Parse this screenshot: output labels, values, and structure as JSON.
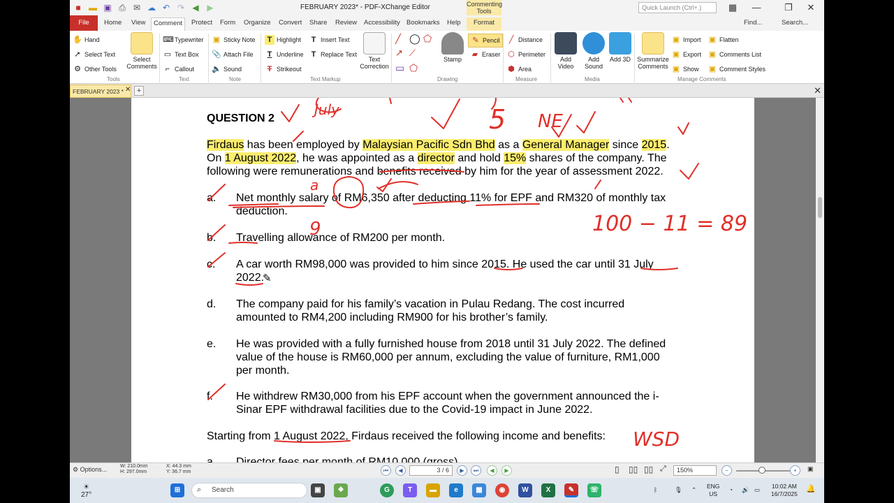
{
  "window": {
    "title": "FEBRUARY 2023* - PDF-XChange Editor",
    "context_tab": "Commenting Tools",
    "quick_launch_placeholder": "Quick Launch (Ctrl+.)",
    "find_label": "Find...",
    "search_label": "Search..."
  },
  "tabs": [
    "File",
    "Home",
    "View",
    "Comment",
    "Protect",
    "Form",
    "Organize",
    "Convert",
    "Share",
    "Review",
    "Accessibility",
    "Bookmarks",
    "Help",
    "Format"
  ],
  "ribbon": {
    "tools": {
      "hand": "Hand",
      "select_text": "Select Text",
      "other_tools": "Other Tools",
      "group": "Tools"
    },
    "select_comments": "Select Comments",
    "text": {
      "typewriter": "Typewriter",
      "text_box": "Text Box",
      "callout": "Callout",
      "group": "Text"
    },
    "note": {
      "sticky_note": "Sticky Note",
      "attach_file": "Attach File",
      "sound": "Sound",
      "group": "Note"
    },
    "markup": {
      "highlight": "Highlight",
      "underline": "Underline",
      "strikeout": "Strikeout",
      "insert_text": "Insert Text",
      "replace_text": "Replace Text",
      "text_correction": "Text Correction",
      "group": "Text Markup"
    },
    "drawing": {
      "stamp": "Stamp",
      "pencil": "Pencil",
      "eraser": "Eraser",
      "group": "Drawing"
    },
    "measure": {
      "distance": "Distance",
      "perimeter": "Perimeter",
      "area": "Area",
      "group": "Measure"
    },
    "media": {
      "add_video": "Add Video",
      "add_sound": "Add Sound",
      "add_3d": "Add 3D",
      "group": "Media"
    },
    "manage": {
      "summarize": "Summarize Comments",
      "import": "Import",
      "export": "Export",
      "show": "Show",
      "flatten": "Flatten",
      "comments_list": "Comments List",
      "comment_styles": "Comment Styles",
      "group": "Manage Comments"
    }
  },
  "document_tab": "FEBRUARY 2023 *",
  "page": {
    "heading": "QUESTION 2",
    "intro": {
      "p1": "Firdaus",
      "p2": " has been employed by ",
      "p3": "Malaysian Pacific Sdn Bhd",
      "p4": " as a ",
      "p5": "General Manager",
      "p6": " since ",
      "p7": "2015",
      "p8": ".",
      "l2a": "On ",
      "l2b": "1 August 2022",
      "l2c": ", he was appointed as a ",
      "l2d": "director",
      "l2e": " and hold ",
      "l2f": "15%",
      "l2g": " shares of the company. The",
      "l3": "following were remunerations and benefits received by him for the year of assessment 2022."
    },
    "items": [
      {
        "label": "a.",
        "line1": "Net monthly salary of RM6,350 after deducting 11% for EPF and RM320 of monthly tax",
        "line2": "deduction."
      },
      {
        "label": "b.",
        "line1": "Travelling allowance of RM200 per month.",
        "line2": ""
      },
      {
        "label": "c.",
        "line1": "A car worth RM98,000 was provided to him since 2015. He used the car until 31 July",
        "line2": "2022."
      },
      {
        "label": "d.",
        "line1": "The company paid for his family’s vacation in Pulau Redang. The cost incurred",
        "line2": "amounted to RM4,200 including RM900 for his brother’s family."
      },
      {
        "label": "e.",
        "line1": "He was provided with a fully furnished house from 2018 until 31 July 2022. The defined",
        "line2": "value of the house is RM60,000 per annum, excluding the value of furniture, RM1,000",
        "line3": "per month."
      },
      {
        "label": "f.",
        "line1": "He withdrew RM30,000 from his EPF account when the government announced the i-",
        "line2": "Sinar EPF withdrawal facilities due to the Covid-19 impact in June 2022."
      }
    ],
    "starting": {
      "a": "Starting from ",
      "b": "1 August 2022",
      "c": ", Firdaus received the following income and benefits:"
    },
    "next_label": "a.",
    "next_line": "Director fees per month of RM10,000 (gross)",
    "handwriting": {
      "top": "July",
      "five": "5",
      "ne": "NE",
      "calc": "100 − 11 = 89",
      "wsd": "WSD",
      "a": "a",
      "nine": "9"
    }
  },
  "status": {
    "options": "Options...",
    "width": "W: 210.0mm",
    "height": "H: 297.0mm",
    "x": "X: 44.3 mm",
    "y": "Y: 36.7 mm",
    "page_box": "3 / 6",
    "zoom": "150%"
  },
  "taskbar": {
    "weather": "27°",
    "search": "Search",
    "lang1": "ENG",
    "lang2": "US",
    "time": "10:02 AM",
    "date": "16/7/2025"
  },
  "colors": {
    "accent_red": "#c8312b",
    "highlight": "#fbed6e",
    "ink": "#e0302a"
  }
}
